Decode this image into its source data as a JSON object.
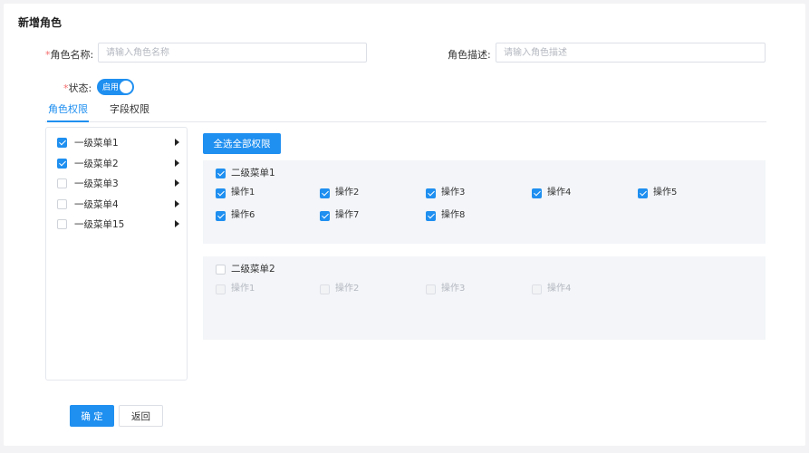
{
  "page_title": "新增角色",
  "form": {
    "role_name": {
      "required_mark": "*",
      "label": "角色名称:",
      "value": "",
      "placeholder": "请输入角色名称"
    },
    "role_desc": {
      "label": "角色描述:",
      "value": "",
      "placeholder": "请输入角色描述"
    },
    "status": {
      "required_mark": "*",
      "label": "状态:",
      "toggle_text": "启用",
      "on": true
    }
  },
  "tabs": [
    {
      "label": "角色权限",
      "active": true
    },
    {
      "label": "字段权限",
      "active": false
    }
  ],
  "menus": [
    {
      "label": "一级菜单1",
      "checked": true
    },
    {
      "label": "一级菜单2",
      "checked": true
    },
    {
      "label": "一级菜单3",
      "checked": false
    },
    {
      "label": "一级菜单4",
      "checked": false
    },
    {
      "label": "一级菜单15",
      "checked": false
    }
  ],
  "select_all_label": "全选全部权限",
  "groups": [
    {
      "title": "二级菜单1",
      "checked": true,
      "disabled": false,
      "actions": [
        {
          "label": "操作1",
          "checked": true
        },
        {
          "label": "操作2",
          "checked": true
        },
        {
          "label": "操作3",
          "checked": true
        },
        {
          "label": "操作4",
          "checked": true
        },
        {
          "label": "操作5",
          "checked": true
        },
        {
          "label": "操作6",
          "checked": true
        },
        {
          "label": "操作7",
          "checked": true
        },
        {
          "label": "操作8",
          "checked": true
        }
      ]
    },
    {
      "title": "二级菜单2",
      "checked": false,
      "disabled": true,
      "actions": [
        {
          "label": "操作1",
          "checked": false
        },
        {
          "label": "操作2",
          "checked": false
        },
        {
          "label": "操作3",
          "checked": false
        },
        {
          "label": "操作4",
          "checked": false
        }
      ]
    }
  ],
  "buttons": {
    "confirm": "确 定",
    "back": "返回"
  },
  "colors": {
    "primary": "#1f8ff0",
    "required": "#f56c6c",
    "group_bg": "#f3f5f8"
  }
}
